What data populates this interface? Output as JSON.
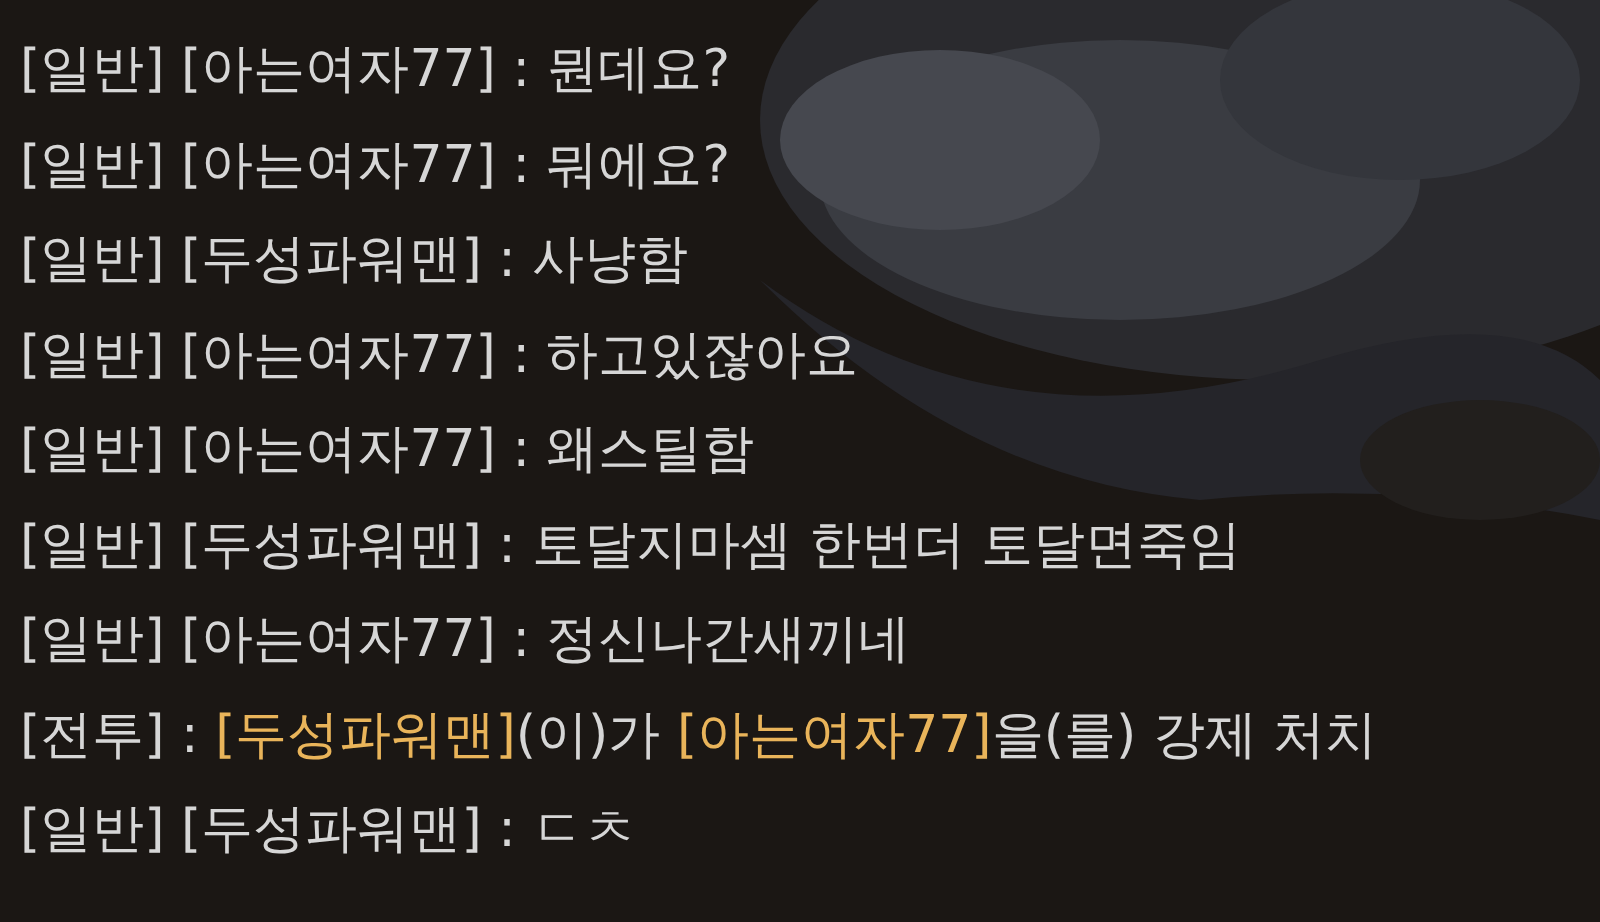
{
  "chat_log": {
    "lines": [
      {
        "kind": "chat",
        "text": "[일반] [아는여자77] : 뭔데요?"
      },
      {
        "kind": "chat",
        "text": "[일반] [아는여자77] : 뭐에요?"
      },
      {
        "kind": "chat",
        "text": "[일반] [두성파워맨] : 사냥함"
      },
      {
        "kind": "chat",
        "text": "[일반] [아는여자77] : 하고있잖아요"
      },
      {
        "kind": "chat",
        "text": "[일반] [아는여자77] : 왜스틸함"
      },
      {
        "kind": "chat",
        "text": "[일반] [두성파워맨] : 토달지마셈 한번더 토달면죽임"
      },
      {
        "kind": "chat",
        "text": "[일반] [아는여자77] : 정신나간새끼네"
      },
      {
        "kind": "system",
        "segments": [
          {
            "text": "[전투] : ",
            "color": "#d6d6d6"
          },
          {
            "text": "[두성파워맨]",
            "color": "#e9b45a"
          },
          {
            "text": "(이)가 ",
            "color": "#d6d6d6"
          },
          {
            "text": "[아는여자77]",
            "color": "#e9b45a"
          },
          {
            "text": "을(를) 강제 처치",
            "color": "#d6d6d6"
          }
        ]
      },
      {
        "kind": "chat",
        "text": "[일반] [두성파워맨] : ㄷㅊ"
      }
    ]
  }
}
